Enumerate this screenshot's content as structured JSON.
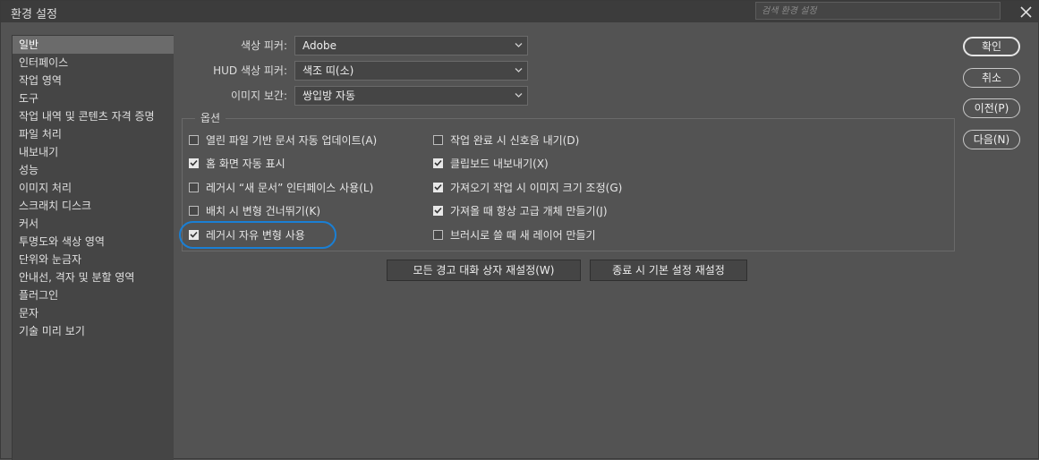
{
  "window": {
    "title": "환경 설정",
    "search_placeholder": "검색 환경 설정"
  },
  "sidebar": {
    "items": [
      {
        "label": "일반",
        "active": true
      },
      {
        "label": "인터페이스"
      },
      {
        "label": "작업 영역"
      },
      {
        "label": "도구"
      },
      {
        "label": "작업 내역 및 콘텐츠 자격 증명"
      },
      {
        "label": "파일 처리"
      },
      {
        "label": "내보내기"
      },
      {
        "label": "성능"
      },
      {
        "label": "이미지 처리"
      },
      {
        "label": "스크래치 디스크"
      },
      {
        "label": "커서"
      },
      {
        "label": "투명도와 색상 영역"
      },
      {
        "label": "단위와 눈금자"
      },
      {
        "label": "안내선, 격자 및 분할 영역"
      },
      {
        "label": "플러그인"
      },
      {
        "label": "문자"
      },
      {
        "label": "기술 미리 보기"
      }
    ]
  },
  "general": {
    "color_picker": {
      "label": "색상 피커:",
      "value": "Adobe"
    },
    "hud_color_picker": {
      "label": "HUD 색상 피커:",
      "value": "색조 띠(소)"
    },
    "image_interpolation": {
      "label": "이미지 보간:",
      "value": "쌍입방 자동"
    }
  },
  "options": {
    "legend": "옵션",
    "left": [
      {
        "label": "열린 파일 기반 문서 자동 업데이트(A)",
        "checked": false
      },
      {
        "label": "홈 화면 자동 표시",
        "checked": true
      },
      {
        "label": "레거시 “새 문서” 인터페이스 사용(L)",
        "checked": false
      },
      {
        "label": "배치 시 변형 건너뛰기(K)",
        "checked": false
      },
      {
        "label": "레거시 자유 변형 사용",
        "checked": true
      }
    ],
    "right": [
      {
        "label": "작업 완료 시 신호음 내기(D)",
        "checked": false
      },
      {
        "label": "클립보드 내보내기(X)",
        "checked": true
      },
      {
        "label": "가져오기 작업 시 이미지 크기 조정(G)",
        "checked": true
      },
      {
        "label": "가져올 때 항상 고급 개체 만들기(J)",
        "checked": true
      },
      {
        "label": "브러시로 쓸 때 새 레이어 만들기",
        "checked": false
      }
    ]
  },
  "actions": {
    "reset_warnings": "모든 경고 대화 상자 재설정(W)",
    "reset_on_quit": "종료 시 기본 설정 재설정"
  },
  "dialog_buttons": {
    "ok": "확인",
    "cancel": "취소",
    "prev": "이전(P)",
    "next": "다음(N)"
  },
  "colors": {
    "highlight_ring": "#1a7fd4",
    "background": "#535353"
  }
}
